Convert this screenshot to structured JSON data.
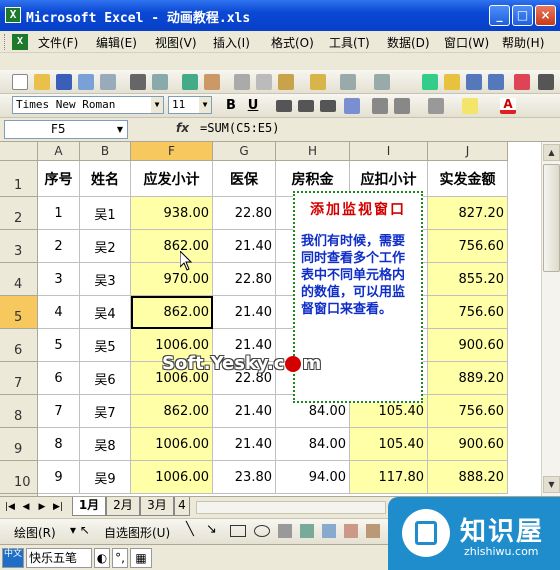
{
  "window": {
    "title": "Microsoft Excel - 动画教程.xls",
    "icon": "excel-icon"
  },
  "menu": [
    "文件(F)",
    "编辑(E)",
    "视图(V)",
    "插入(I)",
    "格式(O)",
    "工具(T)",
    "数据(D)",
    "窗口(W)",
    "帮助(H)"
  ],
  "format": {
    "font": "Times New Roman",
    "size": "11",
    "bold": "B",
    "underline": "U"
  },
  "formula_bar": {
    "name_box": "F5",
    "fx": "fx",
    "formula": "=SUM(C5:E5)"
  },
  "columns": [
    "A",
    "B",
    "F",
    "G",
    "H",
    "I",
    "J"
  ],
  "header_row": {
    "num": "1",
    "cells": [
      "序号",
      "姓名",
      "应发小计",
      "医保",
      "房积金",
      "应扣小计",
      "实发金额"
    ]
  },
  "rows": [
    {
      "num": "2",
      "cells": [
        "1",
        "吴1",
        "938.00",
        "22.80",
        "",
        "",
        "827.20"
      ]
    },
    {
      "num": "3",
      "cells": [
        "2",
        "吴2",
        "862.00",
        "21.40",
        "",
        "",
        "756.60"
      ]
    },
    {
      "num": "4",
      "cells": [
        "3",
        "吴3",
        "970.00",
        "22.80",
        "",
        "",
        "855.20"
      ]
    },
    {
      "num": "5",
      "cells": [
        "4",
        "吴4",
        "862.00",
        "21.40",
        "",
        "",
        "756.60"
      ]
    },
    {
      "num": "6",
      "cells": [
        "5",
        "吴5",
        "1006.00",
        "21.40",
        "",
        "",
        "900.60"
      ]
    },
    {
      "num": "7",
      "cells": [
        "6",
        "吴6",
        "1006.00",
        "22.80",
        "",
        "",
        "889.20"
      ]
    },
    {
      "num": "8",
      "cells": [
        "7",
        "吴7",
        "862.00",
        "21.40",
        "84.00",
        "105.40",
        "756.60"
      ]
    },
    {
      "num": "9",
      "cells": [
        "8",
        "吴8",
        "1006.00",
        "21.40",
        "84.00",
        "105.40",
        "900.60"
      ]
    },
    {
      "num": "10",
      "cells": [
        "9",
        "吴9",
        "1006.00",
        "23.80",
        "94.00",
        "117.80",
        "888.20"
      ]
    }
  ],
  "note": {
    "title": "添加监视窗口",
    "body": "我们有时候，需要同时查看多个工作表中不同单元格内的数值，可以用监督窗口来查看。"
  },
  "watermark": "Soft.Yesky.c",
  "watermark_tail": "m",
  "sheet_tabs": [
    "1月",
    "2月",
    "3月",
    "4"
  ],
  "draw": {
    "label": "绘图(R)",
    "autoshape": "自选图形(U)"
  },
  "ime": {
    "label": "快乐五笔"
  },
  "logo": {
    "name": "知识屋",
    "url": "zhishiwu.com"
  },
  "colors": {
    "selected": "#f5e8a0",
    "highlight": "#ffffa8",
    "note_border": "#1a8a1a",
    "note_title": "#d40000",
    "note_body": "#0f2ec8"
  }
}
